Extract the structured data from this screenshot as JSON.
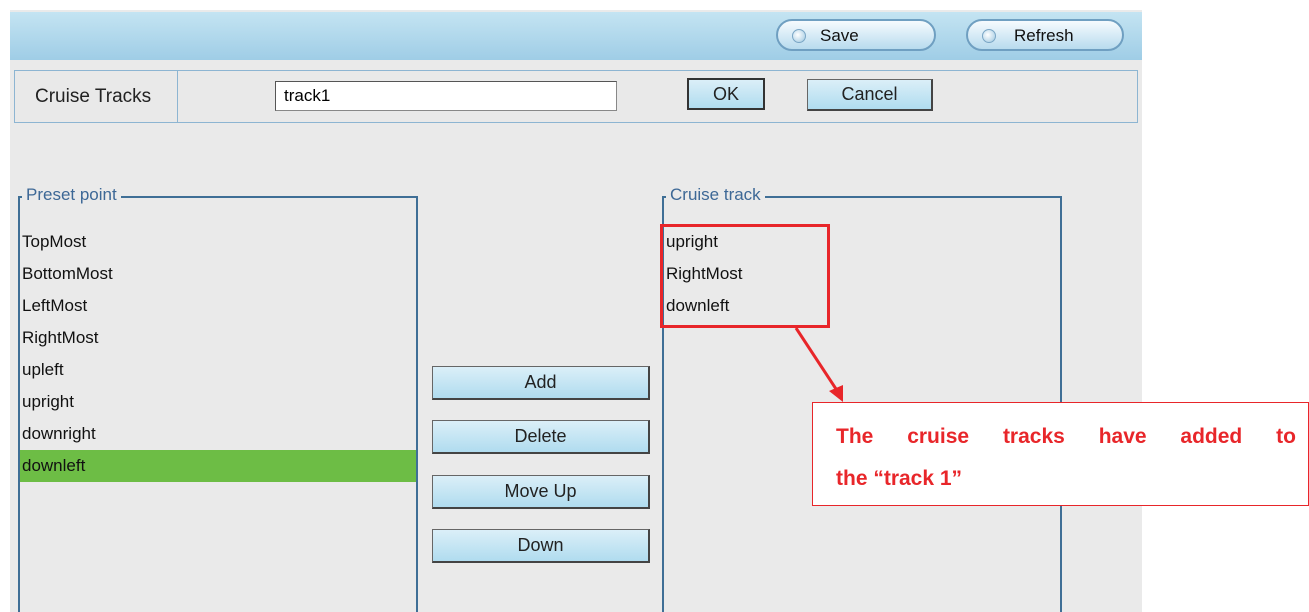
{
  "toolbar": {
    "save_label": "Save",
    "refresh_label": "Refresh"
  },
  "cruise_tracks": {
    "label": "Cruise Tracks",
    "input_value": "track1",
    "ok_label": "OK",
    "cancel_label": "Cancel"
  },
  "preset_point": {
    "legend": "Preset point",
    "items": [
      "TopMost",
      "BottomMost",
      "LeftMost",
      "RightMost",
      "upleft",
      "upright",
      "downright",
      "downleft"
    ],
    "selected": "downleft"
  },
  "actions": {
    "add": "Add",
    "delete": "Delete",
    "move_up": "Move Up",
    "down": "Down"
  },
  "cruise_track": {
    "legend": "Cruise track",
    "items": [
      "upright",
      "RightMost",
      "downleft"
    ]
  },
  "annotation": {
    "line1_words": [
      "The",
      "cruise",
      "tracks",
      "have",
      "added",
      "to"
    ],
    "line2": "the “track 1”",
    "color": "#e8262a"
  },
  "colors": {
    "toolbar_bg": "#b5dcee",
    "panel_bg": "#eaeaea",
    "selection": "#6dbd45",
    "fieldset_border": "#3f6f96",
    "legend_text": "#3d6896"
  }
}
